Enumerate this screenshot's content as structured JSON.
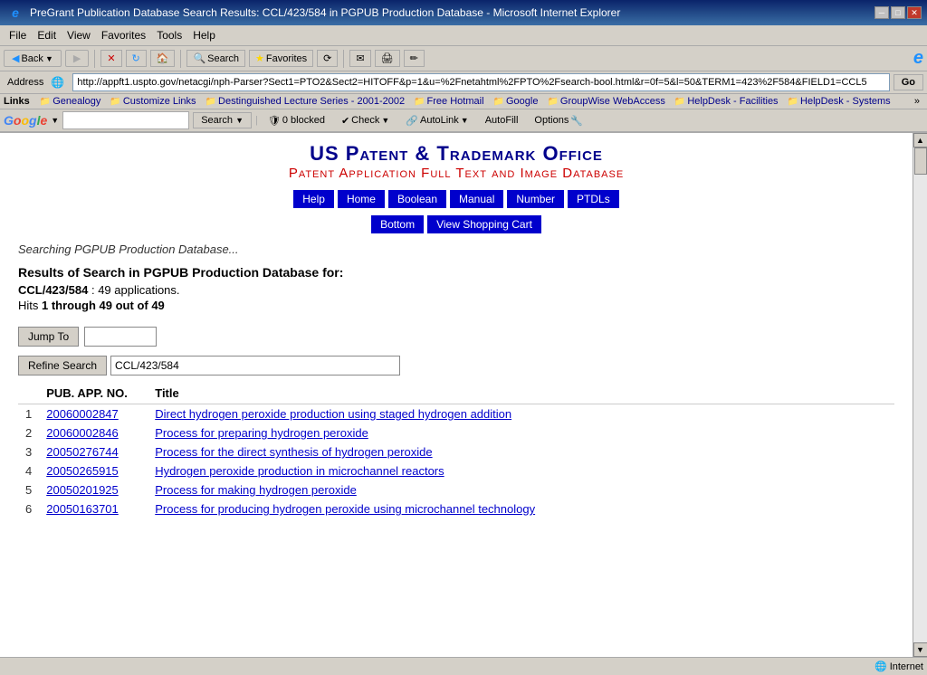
{
  "window": {
    "title": "PreGrant Publication Database Search Results: CCL/423/584 in PGPUB Production Database - Microsoft Internet Explorer",
    "ie_icon": "e"
  },
  "menu": {
    "items": [
      "File",
      "Edit",
      "View",
      "Favorites",
      "Tools",
      "Help"
    ]
  },
  "toolbar": {
    "back_label": "Back",
    "forward_label": "▶",
    "stop_label": "✕",
    "refresh_label": "↻",
    "home_label": "🏠",
    "search_label": "Search",
    "favorites_label": "Favorites",
    "history_label": "⟳",
    "mail_label": "✉",
    "print_label": "🖨",
    "edit_label": "✏"
  },
  "address_bar": {
    "label": "Address",
    "url": "http://appft1.uspto.gov/netacgi/nph-Parser?Sect1=PTO2&Sect2=HITOFF&p=1&u=%2Fnetahtml%2FPTO%2Fsearch-bool.html&r=0f=5&l=50&TERM1=423%2F584&FIELD1=CCL5",
    "go_label": "Go"
  },
  "links_bar": {
    "label": "Links",
    "items": [
      "Genealogy",
      "Customize Links",
      "Destinguished Lecture Series - 2001-2002",
      "Free Hotmail",
      "Google",
      "GroupWise WebAccess",
      "HelpDesk - Facilities",
      "HelpDesk - Systems"
    ],
    "expand_label": "»"
  },
  "google_bar": {
    "logo": "Google",
    "search_label": "Search",
    "dropdown_symbol": "▼",
    "blocked_label": "0 blocked",
    "check_label": "Check",
    "autolink_label": "AutoLink",
    "autofill_label": "AutoFill",
    "options_label": "Options"
  },
  "patent_page": {
    "title_main": "US Patent & Trademark Office",
    "title_sub": "Patent Application Full Text and Image Database",
    "nav_buttons": [
      "Help",
      "Home",
      "Boolean",
      "Manual",
      "Number",
      "PTDLs"
    ],
    "bottom_buttons": [
      "Bottom",
      "View Shopping Cart"
    ],
    "searching_text": "Searching PGPUB Production Database...",
    "results_header": "Results of Search in PGPUB Production Database for:",
    "query_label": "CCL/423/584",
    "query_count": "49 applications.",
    "hits_text": "Hits 1 through 49 out of 49",
    "jump_btn": "Jump To",
    "refine_btn": "Refine Search",
    "refine_value": "CCL/423/584",
    "table_col1": "PUB. APP. NO.",
    "table_col2": "Title",
    "results": [
      {
        "num": "1",
        "app_no": "20060002847",
        "title": "Direct hydrogen peroxide production using staged hydrogen addition"
      },
      {
        "num": "2",
        "app_no": "20060002846",
        "title": "Process for preparing hydrogen peroxide"
      },
      {
        "num": "3",
        "app_no": "20050276744",
        "title": "Process for the direct synthesis of hydrogen peroxide"
      },
      {
        "num": "4",
        "app_no": "20050265915",
        "title": "Hydrogen peroxide production in microchannel reactors"
      },
      {
        "num": "5",
        "app_no": "20050201925",
        "title": "Process for making hydrogen peroxide"
      },
      {
        "num": "6",
        "app_no": "20050163701",
        "title": "Process for producing hydrogen peroxide using microchannel technology"
      }
    ]
  },
  "status_bar": {
    "text": "",
    "zone_icon": "🌐",
    "zone_label": "Internet"
  }
}
